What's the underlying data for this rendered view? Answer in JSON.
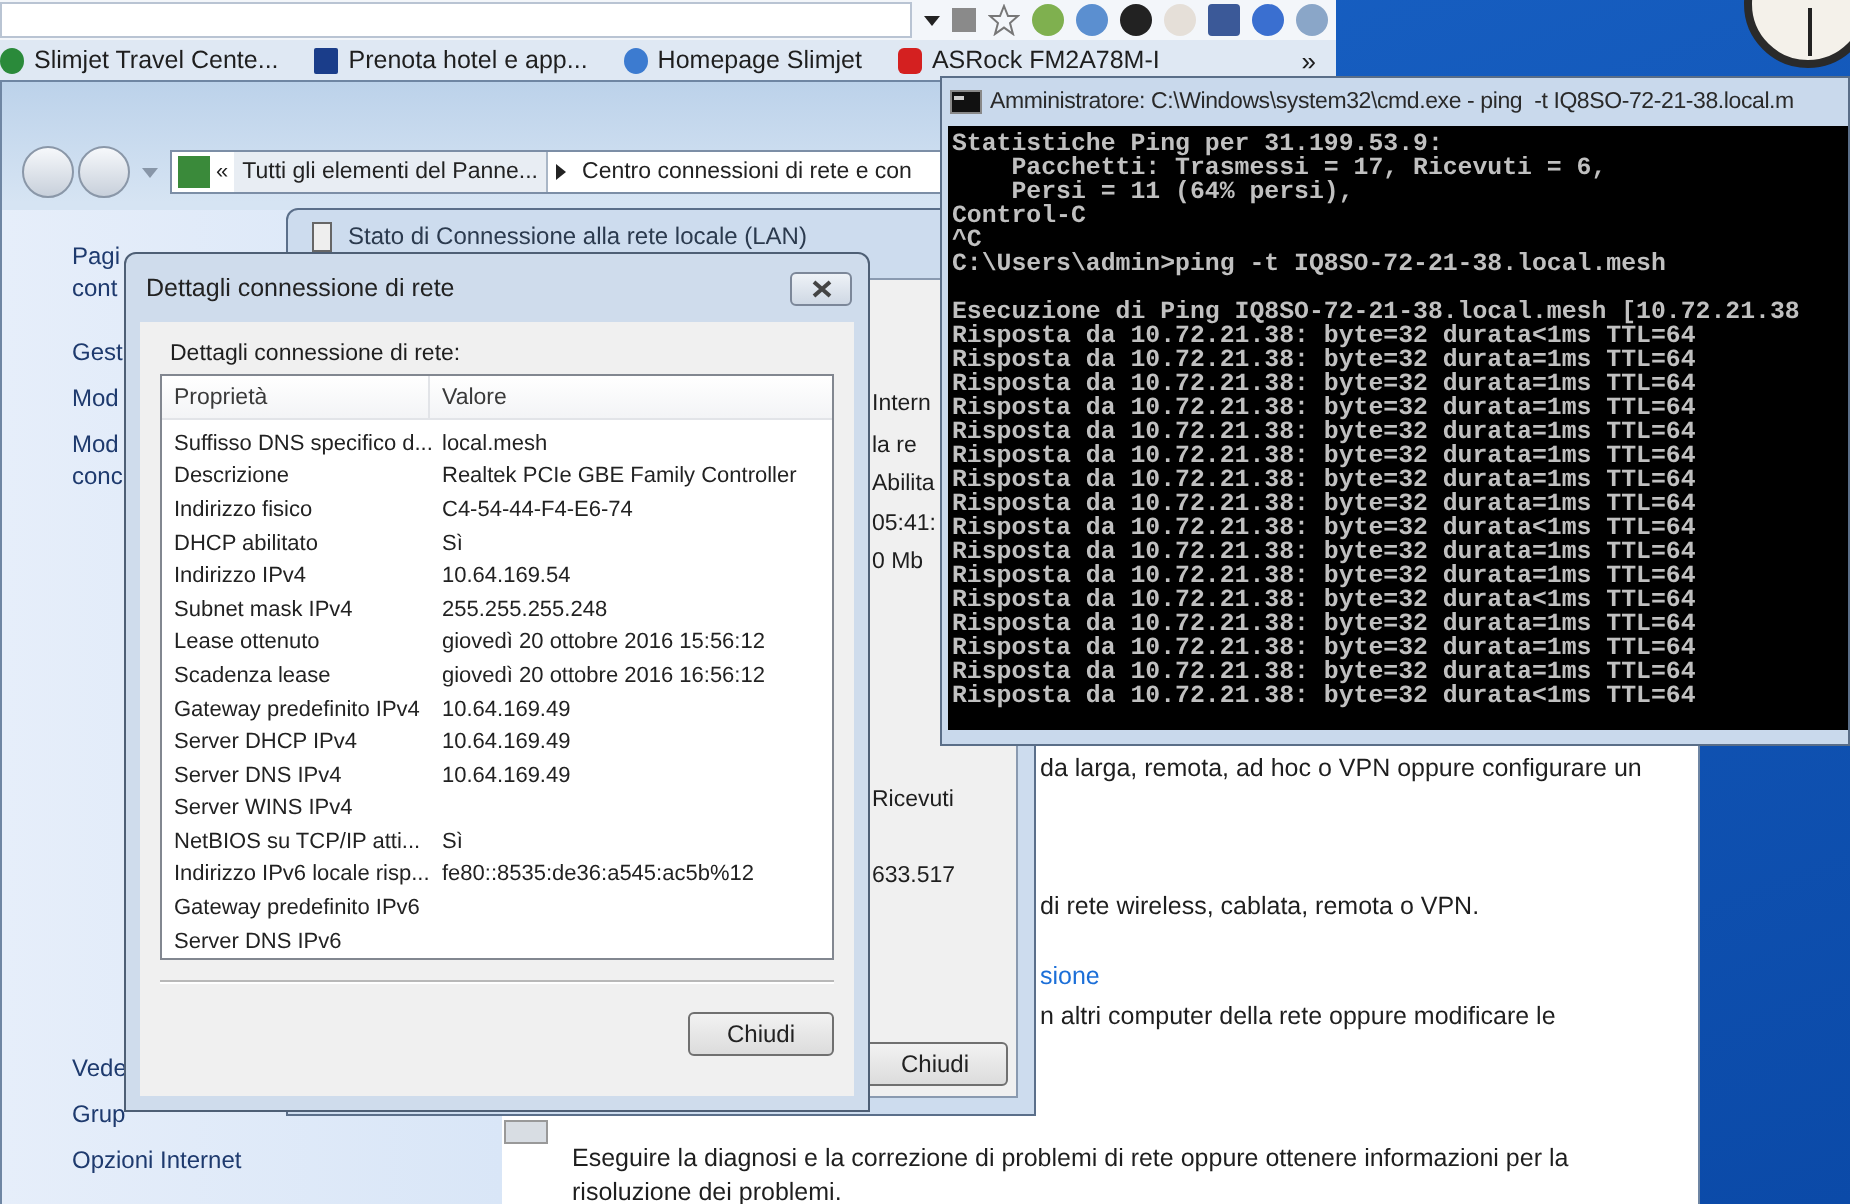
{
  "browser": {
    "bookmarks": [
      {
        "label": "Slimjet Travel Cente..."
      },
      {
        "label": "Prenota hotel e app..."
      },
      {
        "label": "Homepage Slimjet"
      },
      {
        "label": "ASRock FM2A78M-I"
      }
    ],
    "overflow": "»"
  },
  "control_panel": {
    "address_chevron": "«",
    "breadcrumbs": [
      "Tutti gli elementi del Panne...",
      "Centro connessioni di rete e con"
    ],
    "sidebar_fragments": [
      "Pagi",
      "cont",
      "Gest",
      "Mod",
      "Mod",
      "conc",
      "Vede",
      "Grup"
    ],
    "sidebar_items": [
      "Opzioni Internet"
    ],
    "content_fragments": [
      {
        "text": "da larga, remota, ad hoc o VPN oppure configurare un",
        "kind": "text"
      },
      {
        "text": "di rete wireless, cablata, remota o VPN.",
        "kind": "text"
      },
      {
        "text": "sione",
        "kind": "link"
      },
      {
        "text": "n altri computer della rete oppure modificare le",
        "kind": "text"
      }
    ],
    "content_paragraph": [
      "Eseguire la diagnosi e la correzione di problemi di rete oppure ottenere informazioni per la",
      "risoluzione dei problemi."
    ]
  },
  "status_window": {
    "title": "Stato di Connessione alla rete locale (LAN)",
    "fragments": [
      "Intern",
      "la re",
      "Abilita",
      "05:41:",
      "0 Mb",
      "Ricevuti",
      "633.517"
    ],
    "button": "Chiudi"
  },
  "details_dialog": {
    "title": "Dettagli connessione di rete",
    "label": "Dettagli connessione di rete:",
    "columns": [
      "Proprietà",
      "Valore"
    ],
    "rows": [
      {
        "property": "Suffisso DNS specifico d...",
        "value": "local.mesh"
      },
      {
        "property": "Descrizione",
        "value": "Realtek PCIe GBE Family Controller"
      },
      {
        "property": "Indirizzo fisico",
        "value": "C4-54-44-F4-E6-74"
      },
      {
        "property": "DHCP abilitato",
        "value": "Sì"
      },
      {
        "property": "Indirizzo IPv4",
        "value": "10.64.169.54"
      },
      {
        "property": "Subnet mask IPv4",
        "value": "255.255.255.248"
      },
      {
        "property": "Lease ottenuto",
        "value": "giovedì 20 ottobre 2016 15:56:12"
      },
      {
        "property": "Scadenza lease",
        "value": "giovedì 20 ottobre 2016 16:56:12"
      },
      {
        "property": "Gateway predefinito IPv4",
        "value": "10.64.169.49"
      },
      {
        "property": "Server DHCP IPv4",
        "value": "10.64.169.49"
      },
      {
        "property": "Server DNS IPv4",
        "value": "10.64.169.49"
      },
      {
        "property": "Server WINS IPv4"
      },
      {
        "property": "NetBIOS su TCP/IP atti...",
        "value": "Sì"
      },
      {
        "property": "Indirizzo IPv6 locale risp...",
        "value": "fe80::8535:de36:a545:ac5b%12"
      },
      {
        "property": "Gateway predefinito IPv6"
      },
      {
        "property": "Server DNS IPv6"
      }
    ],
    "button": "Chiudi"
  },
  "console": {
    "title": "Amministratore: C:\\Windows\\system32\\cmd.exe - ping  -t IQ8SO-72-21-38.local.m",
    "blocks": [
      [
        "Statistiche Ping per 31.199.53.9:",
        "    Pacchetti: Trasmessi = 17, Ricevuti = 6,",
        "    Persi = 11 (64% persi),",
        "Control-C",
        "^C",
        "C:\\Users\\admin>ping -t IQ8SO-72-21-38.local.mesh"
      ],
      [
        "Esecuzione di Ping IQ8SO-72-21-38.local.mesh [10.72.21.38",
        "Risposta da 10.72.21.38: byte=32 durata<1ms TTL=64",
        "Risposta da 10.72.21.38: byte=32 durata=1ms TTL=64",
        "Risposta da 10.72.21.38: byte=32 durata=1ms TTL=64",
        "Risposta da 10.72.21.38: byte=32 durata=1ms TTL=64",
        "Risposta da 10.72.21.38: byte=32 durata=1ms TTL=64",
        "Risposta da 10.72.21.38: byte=32 durata=1ms TTL=64",
        "Risposta da 10.72.21.38: byte=32 durata=1ms TTL=64",
        "Risposta da 10.72.21.38: byte=32 durata=1ms TTL=64",
        "Risposta da 10.72.21.38: byte=32 durata<1ms TTL=64",
        "Risposta da 10.72.21.38: byte=32 durata=1ms TTL=64",
        "Risposta da 10.72.21.38: byte=32 durata=1ms TTL=64",
        "Risposta da 10.72.21.38: byte=32 durata<1ms TTL=64",
        "Risposta da 10.72.21.38: byte=32 durata=1ms TTL=64",
        "Risposta da 10.72.21.38: byte=32 durata=1ms TTL=64",
        "Risposta da 10.72.21.38: byte=32 durata=1ms TTL=64",
        "Risposta da 10.72.21.38: byte=32 durata<1ms TTL=64"
      ]
    ]
  }
}
